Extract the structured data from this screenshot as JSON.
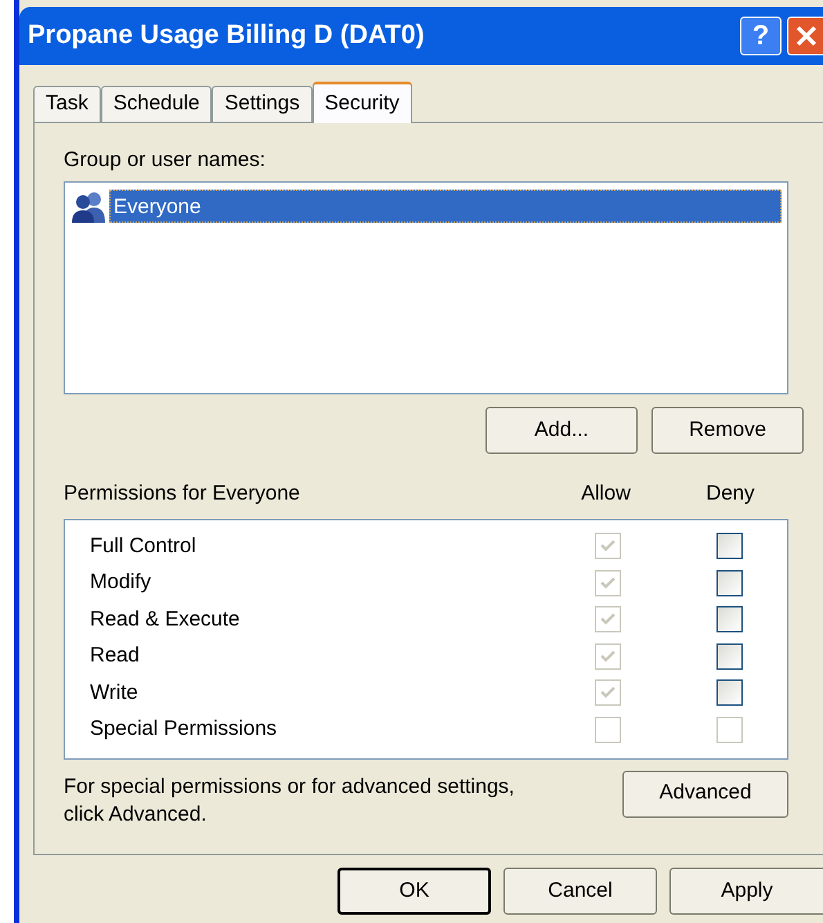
{
  "window": {
    "title": "Propane Usage Billing D (DAT0)",
    "help_button": "?"
  },
  "tabs": [
    {
      "label": "Task",
      "selected": false
    },
    {
      "label": "Schedule",
      "selected": false
    },
    {
      "label": "Settings",
      "selected": false
    },
    {
      "label": "Security",
      "selected": true
    }
  ],
  "group_label": "Group or user names:",
  "users": [
    {
      "name": "Everyone",
      "selected": true
    }
  ],
  "user_buttons": [
    "Add...",
    "Remove"
  ],
  "permissions_label": "Permissions for Everyone",
  "columns": [
    "Allow",
    "Deny"
  ],
  "permissions": [
    {
      "name": "Full Control",
      "allow": {
        "checked": true,
        "disabled": true
      },
      "deny": {
        "checked": false,
        "disabled": false
      }
    },
    {
      "name": "Modify",
      "allow": {
        "checked": true,
        "disabled": true
      },
      "deny": {
        "checked": false,
        "disabled": false
      }
    },
    {
      "name": "Read & Execute",
      "allow": {
        "checked": true,
        "disabled": true
      },
      "deny": {
        "checked": false,
        "disabled": false
      }
    },
    {
      "name": "Read",
      "allow": {
        "checked": true,
        "disabled": true
      },
      "deny": {
        "checked": false,
        "disabled": false
      }
    },
    {
      "name": "Write",
      "allow": {
        "checked": true,
        "disabled": true
      },
      "deny": {
        "checked": false,
        "disabled": false
      }
    },
    {
      "name": "Special Permissions",
      "allow": {
        "checked": false,
        "disabled": true
      },
      "deny": {
        "checked": false,
        "disabled": true
      }
    }
  ],
  "advanced_note": "For special permissions or for advanced settings, click Advanced.",
  "advanced_button": "Advanced",
  "dialog_buttons": [
    {
      "label": "OK",
      "default": true
    },
    {
      "label": "Cancel",
      "default": false
    },
    {
      "label": "Apply",
      "default": false
    }
  ]
}
